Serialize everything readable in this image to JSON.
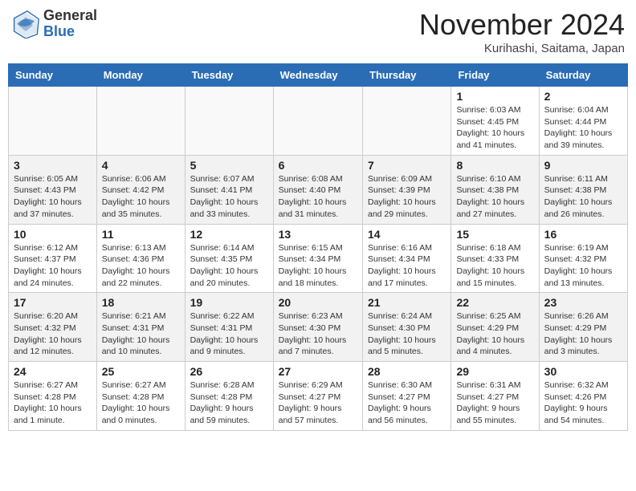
{
  "header": {
    "logo_general": "General",
    "logo_blue": "Blue",
    "month_title": "November 2024",
    "location": "Kurihashi, Saitama, Japan"
  },
  "weekdays": [
    "Sunday",
    "Monday",
    "Tuesday",
    "Wednesday",
    "Thursday",
    "Friday",
    "Saturday"
  ],
  "weeks": [
    [
      {
        "day": "",
        "info": ""
      },
      {
        "day": "",
        "info": ""
      },
      {
        "day": "",
        "info": ""
      },
      {
        "day": "",
        "info": ""
      },
      {
        "day": "",
        "info": ""
      },
      {
        "day": "1",
        "info": "Sunrise: 6:03 AM\nSunset: 4:45 PM\nDaylight: 10 hours\nand 41 minutes."
      },
      {
        "day": "2",
        "info": "Sunrise: 6:04 AM\nSunset: 4:44 PM\nDaylight: 10 hours\nand 39 minutes."
      }
    ],
    [
      {
        "day": "3",
        "info": "Sunrise: 6:05 AM\nSunset: 4:43 PM\nDaylight: 10 hours\nand 37 minutes."
      },
      {
        "day": "4",
        "info": "Sunrise: 6:06 AM\nSunset: 4:42 PM\nDaylight: 10 hours\nand 35 minutes."
      },
      {
        "day": "5",
        "info": "Sunrise: 6:07 AM\nSunset: 4:41 PM\nDaylight: 10 hours\nand 33 minutes."
      },
      {
        "day": "6",
        "info": "Sunrise: 6:08 AM\nSunset: 4:40 PM\nDaylight: 10 hours\nand 31 minutes."
      },
      {
        "day": "7",
        "info": "Sunrise: 6:09 AM\nSunset: 4:39 PM\nDaylight: 10 hours\nand 29 minutes."
      },
      {
        "day": "8",
        "info": "Sunrise: 6:10 AM\nSunset: 4:38 PM\nDaylight: 10 hours\nand 27 minutes."
      },
      {
        "day": "9",
        "info": "Sunrise: 6:11 AM\nSunset: 4:38 PM\nDaylight: 10 hours\nand 26 minutes."
      }
    ],
    [
      {
        "day": "10",
        "info": "Sunrise: 6:12 AM\nSunset: 4:37 PM\nDaylight: 10 hours\nand 24 minutes."
      },
      {
        "day": "11",
        "info": "Sunrise: 6:13 AM\nSunset: 4:36 PM\nDaylight: 10 hours\nand 22 minutes."
      },
      {
        "day": "12",
        "info": "Sunrise: 6:14 AM\nSunset: 4:35 PM\nDaylight: 10 hours\nand 20 minutes."
      },
      {
        "day": "13",
        "info": "Sunrise: 6:15 AM\nSunset: 4:34 PM\nDaylight: 10 hours\nand 18 minutes."
      },
      {
        "day": "14",
        "info": "Sunrise: 6:16 AM\nSunset: 4:34 PM\nDaylight: 10 hours\nand 17 minutes."
      },
      {
        "day": "15",
        "info": "Sunrise: 6:18 AM\nSunset: 4:33 PM\nDaylight: 10 hours\nand 15 minutes."
      },
      {
        "day": "16",
        "info": "Sunrise: 6:19 AM\nSunset: 4:32 PM\nDaylight: 10 hours\nand 13 minutes."
      }
    ],
    [
      {
        "day": "17",
        "info": "Sunrise: 6:20 AM\nSunset: 4:32 PM\nDaylight: 10 hours\nand 12 minutes."
      },
      {
        "day": "18",
        "info": "Sunrise: 6:21 AM\nSunset: 4:31 PM\nDaylight: 10 hours\nand 10 minutes."
      },
      {
        "day": "19",
        "info": "Sunrise: 6:22 AM\nSunset: 4:31 PM\nDaylight: 10 hours\nand 9 minutes."
      },
      {
        "day": "20",
        "info": "Sunrise: 6:23 AM\nSunset: 4:30 PM\nDaylight: 10 hours\nand 7 minutes."
      },
      {
        "day": "21",
        "info": "Sunrise: 6:24 AM\nSunset: 4:30 PM\nDaylight: 10 hours\nand 5 minutes."
      },
      {
        "day": "22",
        "info": "Sunrise: 6:25 AM\nSunset: 4:29 PM\nDaylight: 10 hours\nand 4 minutes."
      },
      {
        "day": "23",
        "info": "Sunrise: 6:26 AM\nSunset: 4:29 PM\nDaylight: 10 hours\nand 3 minutes."
      }
    ],
    [
      {
        "day": "24",
        "info": "Sunrise: 6:27 AM\nSunset: 4:28 PM\nDaylight: 10 hours\nand 1 minute."
      },
      {
        "day": "25",
        "info": "Sunrise: 6:27 AM\nSunset: 4:28 PM\nDaylight: 10 hours\nand 0 minutes."
      },
      {
        "day": "26",
        "info": "Sunrise: 6:28 AM\nSunset: 4:28 PM\nDaylight: 9 hours\nand 59 minutes."
      },
      {
        "day": "27",
        "info": "Sunrise: 6:29 AM\nSunset: 4:27 PM\nDaylight: 9 hours\nand 57 minutes."
      },
      {
        "day": "28",
        "info": "Sunrise: 6:30 AM\nSunset: 4:27 PM\nDaylight: 9 hours\nand 56 minutes."
      },
      {
        "day": "29",
        "info": "Sunrise: 6:31 AM\nSunset: 4:27 PM\nDaylight: 9 hours\nand 55 minutes."
      },
      {
        "day": "30",
        "info": "Sunrise: 6:32 AM\nSunset: 4:26 PM\nDaylight: 9 hours\nand 54 minutes."
      }
    ]
  ]
}
